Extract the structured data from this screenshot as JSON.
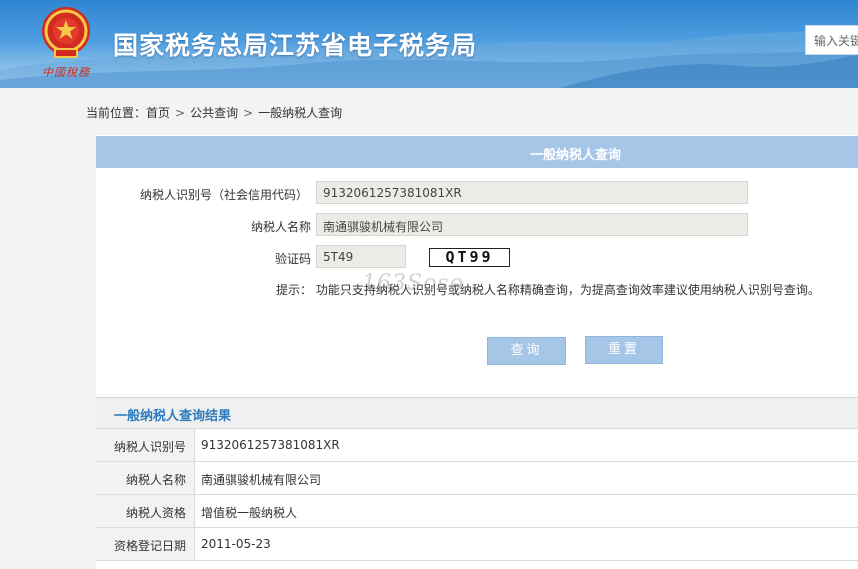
{
  "header": {
    "site_title": "国家税务总局江苏省电子税务局",
    "search_placeholder": "输入关键",
    "logo_icon": "tax-emblem-icon",
    "brand_colors": {
      "header_top": "#2f86d1",
      "header_bottom": "#b9d8f0",
      "emblem_red": "#d12a1f"
    }
  },
  "breadcrumb": {
    "prefix": "当前位置：",
    "items": [
      "首页",
      "公共查询",
      "一般纳税人查询"
    ]
  },
  "form": {
    "title": "一般纳税人查询",
    "taxpayer_id_label": "纳税人识别号（社会信用代码）",
    "taxpayer_id_value": "9132061257381081XR",
    "taxpayer_name_label": "纳税人名称",
    "taxpayer_name_value": "南通骐骏机械有限公司",
    "captcha_label": "验证码",
    "captcha_value": "5T49",
    "captcha_image_text": "QT99",
    "tip": "提示：  功能只支持纳税人识别号或纳税人名称精确查询，为提高查询效率建议使用纳税人识别号查询。",
    "query_button": "查询",
    "reset_button": "重置",
    "accent_color": "#a5c6e6"
  },
  "result": {
    "title": "一般纳税人查询结果",
    "rows": [
      {
        "label": "纳税人识别号",
        "value": "9132061257381081XR"
      },
      {
        "label": "纳税人名称",
        "value": "南通骐骏机械有限公司"
      },
      {
        "label": "纳税人资格",
        "value": "增值税一般纳税人"
      },
      {
        "label": "资格登记日期",
        "value": "2011-05-23"
      }
    ]
  }
}
